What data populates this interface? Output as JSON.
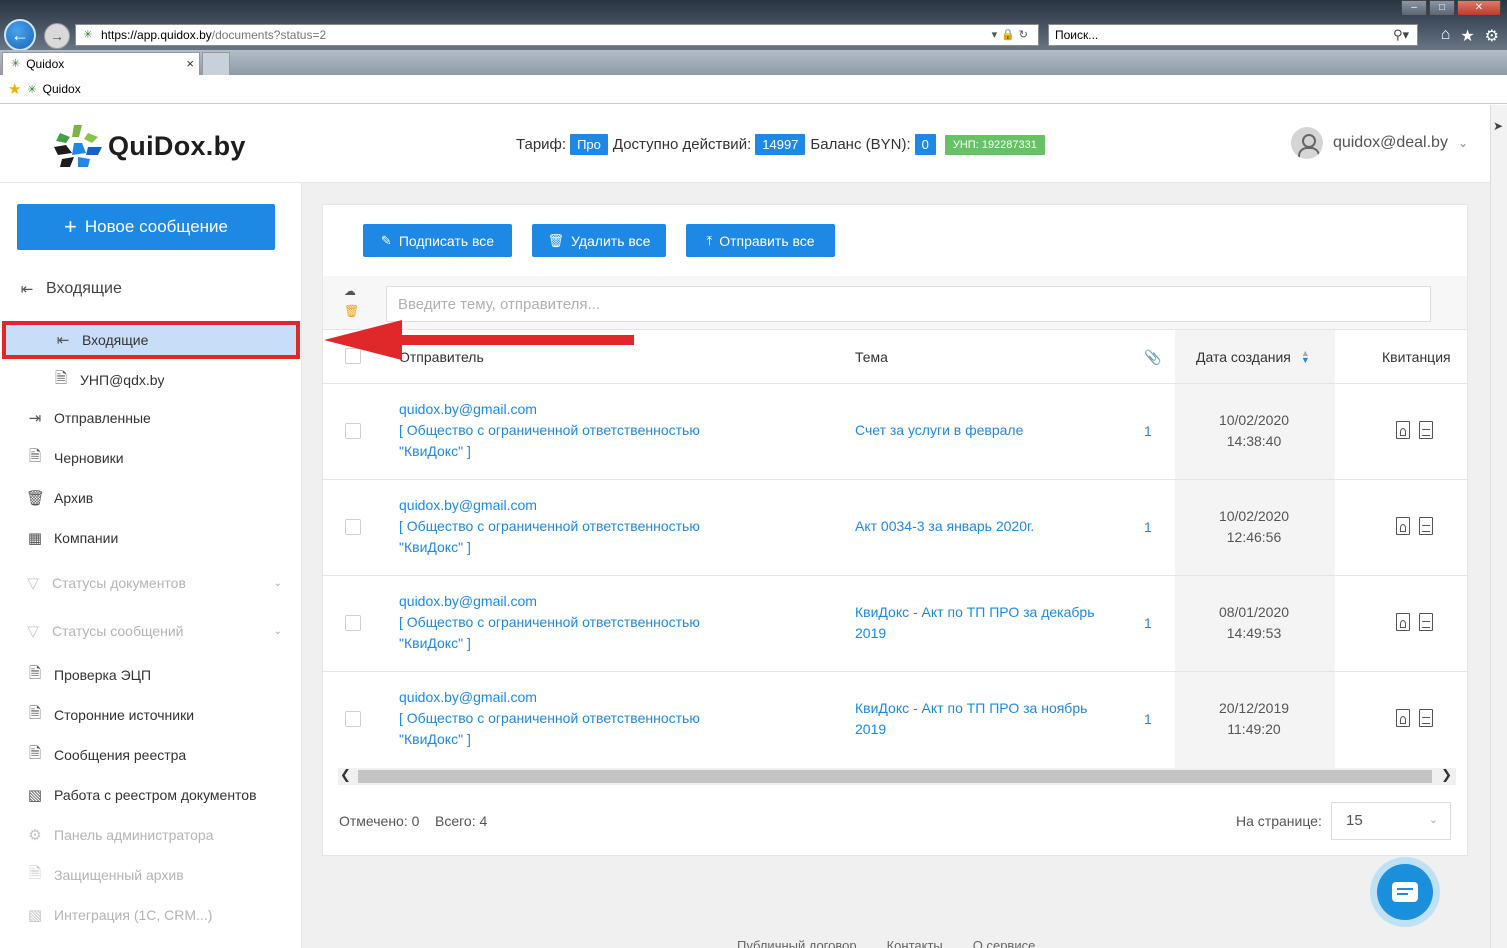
{
  "browser": {
    "url_host": "https://app.quidox.by",
    "url_path": "/documents?status=2",
    "search_placeholder": "Поиск...",
    "tab_title": "Quidox",
    "favorite_label": "Quidox"
  },
  "header": {
    "logo_text": "QuiDox.by",
    "tariff_label": "Тариф:",
    "tariff_value": "Про",
    "actions_label": "Доступно действий:",
    "actions_value": "14997",
    "balance_label": "Баланс (BYN):",
    "balance_value": "0",
    "unp_badge": "УНП: 192287331",
    "user_email": "quidox@deal.by"
  },
  "sidebar": {
    "new_message": "Новое сообщение",
    "inbox_group": "Входящие",
    "inbox_sub": "Входящие",
    "unp_item": "УНП@qdx.by",
    "items": [
      {
        "label": "Отправленные",
        "icon": "sent-icon"
      },
      {
        "label": "Черновики",
        "icon": "drafts-icon"
      },
      {
        "label": "Архив",
        "icon": "archive-icon"
      },
      {
        "label": "Компании",
        "icon": "companies-icon"
      }
    ],
    "doc_statuses": "Статусы документов",
    "msg_statuses": "Статусы сообщений",
    "items2": [
      {
        "label": "Проверка ЭЦП",
        "disabled": false
      },
      {
        "label": "Сторонние источники",
        "disabled": false
      },
      {
        "label": "Сообщения реестра",
        "disabled": false
      },
      {
        "label": "Работа с реестром документов",
        "disabled": false
      },
      {
        "label": "Панель администратора",
        "disabled": true
      },
      {
        "label": "Защищенный архив",
        "disabled": true
      },
      {
        "label": "Интеграция (1С, CRM...)",
        "disabled": true
      }
    ]
  },
  "toolbar": {
    "sign_all": "Подписать все",
    "delete_all": "Удалить все",
    "send_all": "Отправить все"
  },
  "search": {
    "placeholder": "Введите тему, отправителя..."
  },
  "table": {
    "columns": {
      "sender": "Отправитель",
      "subject": "Тема",
      "date": "Дата создания",
      "receipt": "Квитанция"
    },
    "rows": [
      {
        "email": "quidox.by@gmail.com",
        "org1": "[ Общество с ограниченной ответственностью",
        "org2": "\"КвиДокс\" ]",
        "subject": "Счет за услуги в феврале",
        "count": "1",
        "date": "10/02/2020",
        "time": "14:38:40"
      },
      {
        "email": "quidox.by@gmail.com",
        "org1": "[ Общество с ограниченной ответственностью",
        "org2": "\"КвиДокс\" ]",
        "subject": "Акт 0034-3 за январь 2020г.",
        "count": "1",
        "date": "10/02/2020",
        "time": "12:46:56"
      },
      {
        "email": "quidox.by@gmail.com",
        "org1": "[ Общество с ограниченной ответственностью",
        "org2": "\"КвиДокс\" ]",
        "subject": "КвиДокс - Акт по ТП ПРО за декабрь 2019",
        "count": "1",
        "date": "08/01/2020",
        "time": "14:49:53"
      },
      {
        "email": "quidox.by@gmail.com",
        "org1": "[ Общество с ограниченной ответственностью",
        "org2": "\"КвиДокс\" ]",
        "subject": "КвиДокс - Акт по ТП ПРО за ноябрь 2019",
        "count": "1",
        "date": "20/12/2019",
        "time": "11:49:20"
      }
    ]
  },
  "footer": {
    "selected": "Отмечено: 0",
    "total": "Всего: 4",
    "per_page_label": "На странице:",
    "per_page_value": "15",
    "links": [
      "Публичный договор",
      "Контакты",
      "О сервисе"
    ]
  },
  "colors": {
    "accent": "#1e88e5",
    "annotation": "#e0272a",
    "unp_badge": "#66c265"
  }
}
